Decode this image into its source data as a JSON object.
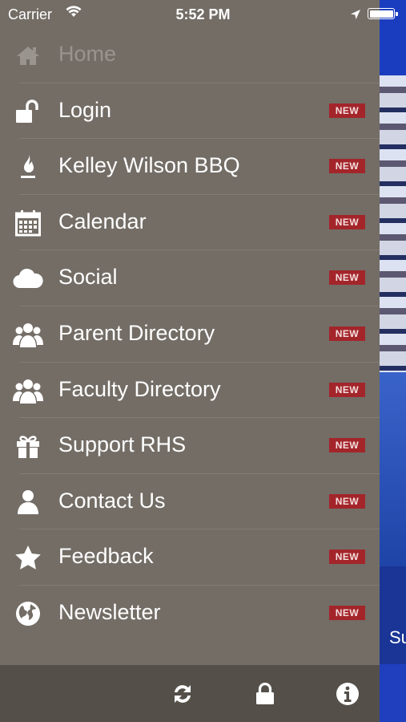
{
  "status_bar": {
    "carrier": "Carrier",
    "time": "5:52 PM"
  },
  "menu": {
    "items": [
      {
        "label": "Home",
        "icon": "home-icon",
        "badge": ""
      },
      {
        "label": "Login",
        "icon": "unlock-icon",
        "badge": "NEW"
      },
      {
        "label": "Kelley Wilson BBQ",
        "icon": "flame-icon",
        "badge": "NEW"
      },
      {
        "label": "Calendar",
        "icon": "calendar-icon",
        "badge": "NEW"
      },
      {
        "label": "Social",
        "icon": "cloud-icon",
        "badge": "NEW"
      },
      {
        "label": "Parent Directory",
        "icon": "group-icon",
        "badge": "NEW"
      },
      {
        "label": "Faculty Directory",
        "icon": "group-icon",
        "badge": "NEW"
      },
      {
        "label": "Support RHS",
        "icon": "gift-icon",
        "badge": "NEW"
      },
      {
        "label": "Contact Us",
        "icon": "person-icon",
        "badge": "NEW"
      },
      {
        "label": "Feedback",
        "icon": "star-icon",
        "badge": "NEW"
      },
      {
        "label": "Newsletter",
        "icon": "globe-icon",
        "badge": "NEW"
      }
    ]
  },
  "footer": {
    "icons": [
      "refresh-icon",
      "lock-icon",
      "info-icon"
    ]
  },
  "backdrop": {
    "partial_text": "Su"
  },
  "colors": {
    "drawer": "#736d66",
    "footer": "#545049",
    "badge": "#a3252a",
    "accent_blue": "#1c3fae"
  }
}
